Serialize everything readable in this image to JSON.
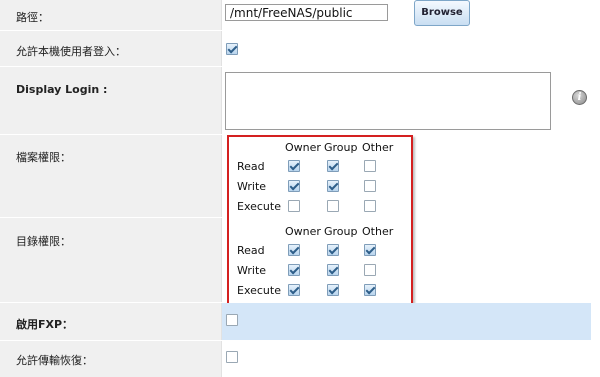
{
  "path_row": {
    "label": "路徑：",
    "value": "/mnt/FreeNAS/public",
    "browse_label": "Browse"
  },
  "allow_local_login": {
    "label": "允許本機使用者登入：",
    "checked": true
  },
  "display_login": {
    "label": "Display Login :",
    "value": "",
    "info_icon": "info-icon"
  },
  "file_permissions": {
    "label": "檔案權限：",
    "headers": [
      "Owner",
      "Group",
      "Other"
    ],
    "rows": [
      {
        "name": "Read",
        "values": [
          true,
          true,
          false
        ]
      },
      {
        "name": "Write",
        "values": [
          true,
          true,
          false
        ]
      },
      {
        "name": "Execute",
        "values": [
          false,
          false,
          false
        ]
      }
    ]
  },
  "dir_permissions": {
    "label": "目錄權限：",
    "headers": [
      "Owner",
      "Group",
      "Other"
    ],
    "rows": [
      {
        "name": "Read",
        "values": [
          true,
          true,
          true
        ]
      },
      {
        "name": "Write",
        "values": [
          true,
          true,
          false
        ]
      },
      {
        "name": "Execute",
        "values": [
          true,
          true,
          true
        ]
      }
    ]
  },
  "enable_fxp": {
    "label": "啟用FXP：",
    "checked": false
  },
  "allow_resume": {
    "label": "允許傳輸恢復：",
    "checked": false
  },
  "colors": {
    "highlight_border": "#d42020",
    "label_bg": "#f0f0f0",
    "selected_band": "#d4e6f8"
  }
}
